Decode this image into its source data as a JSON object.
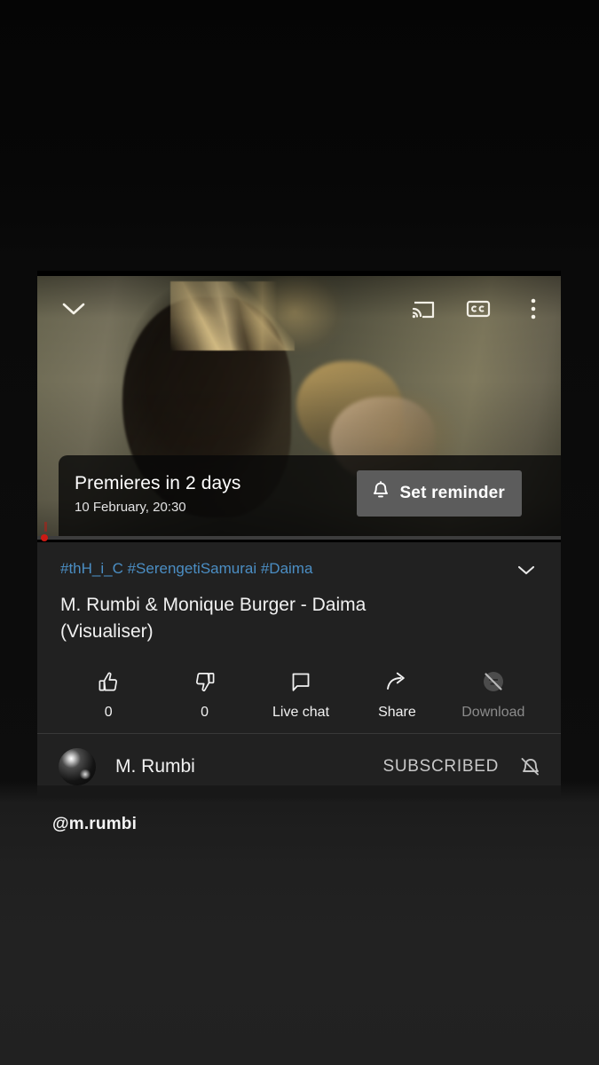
{
  "background": {
    "top_color": "#070707",
    "bottom_color": "#212121"
  },
  "player": {
    "collapse_icon": "chevron-down-icon",
    "cast_icon": "cast-icon",
    "captions_icon": "closed-captions-icon",
    "more_icon": "more-vertical-icon",
    "premiere": {
      "headline": "Premieres in 2 days",
      "datetime": "10 February, 20:30",
      "reminder_button_label": "Set reminder",
      "reminder_icon": "bell-icon",
      "reminder_button_color": "#5c5c5c"
    },
    "progress": {
      "elapsed_percent": 0,
      "played_color": "#cc1a14",
      "rail_color": "#3d3d3d"
    }
  },
  "metadata": {
    "hashtags": "#thH_i_C #SerengetiSamurai #Daima",
    "hashtag_color": "#4b8ec4",
    "title": "M. Rumbi & Monique Burger - Daima (Visualiser)",
    "expand_icon": "chevron-down-icon"
  },
  "actions": [
    {
      "id": "like",
      "label": "0",
      "icon": "thumb-up-icon",
      "disabled": false
    },
    {
      "id": "dislike",
      "label": "0",
      "icon": "thumb-down-icon",
      "disabled": false
    },
    {
      "id": "live-chat",
      "label": "Live chat",
      "icon": "chat-bubble-icon",
      "disabled": false
    },
    {
      "id": "share",
      "label": "Share",
      "icon": "share-arrow-icon",
      "disabled": false
    },
    {
      "id": "download",
      "label": "Download",
      "icon": "download-disabled-icon",
      "disabled": true
    }
  ],
  "channel": {
    "name": "M. Rumbi",
    "avatar_icon": "channel-avatar",
    "subscribe_state": "SUBSCRIBED",
    "notification_icon": "bell-off-icon"
  },
  "caption": {
    "handle": "@m.rumbi"
  }
}
